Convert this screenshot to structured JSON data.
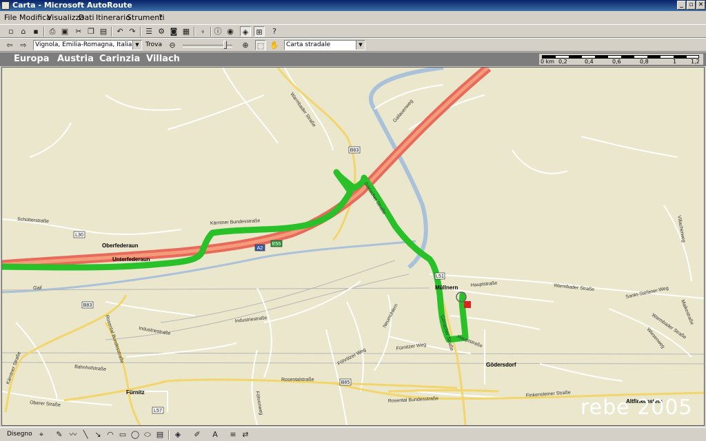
{
  "window": {
    "title": "Carta - Microsoft AutoRoute",
    "min": "_",
    "restore": "▫",
    "close": "✕"
  },
  "menu": [
    "File",
    "Modifica",
    "Visualizza",
    "Dati",
    "Itinerario",
    "Strumenti",
    "?"
  ],
  "toolbar2": {
    "location_value": "Vignola, Emilia-Romagna, Italia",
    "find_label": "Trova",
    "map_style_value": "Carta stradale",
    "back_icon": "arrow-left-icon",
    "forward_icon": "arrow-right-icon",
    "zoom_out_icon": "zoom-out-icon",
    "zoom_in_icon": "zoom-in-icon",
    "select_icon": "select-area-icon",
    "pan_icon": "hand-icon"
  },
  "breadcrumb": [
    "Europa",
    "Austria",
    "Carinzia",
    "Villach"
  ],
  "scale": {
    "unit": "0 km",
    "ticks": [
      "0,2",
      "0,4",
      "0,6",
      "0,8",
      "1",
      "1,2"
    ]
  },
  "map": {
    "places": [
      "Oberfederaun",
      "Unterfederaun",
      "Müllnern",
      "Gödersdorf",
      "Fürnitz",
      "Altfinkenstein"
    ],
    "streets": [
      "Schütterstraße",
      "Kärntner Bundesstraße",
      "Warmbader Straße",
      "Gailauenweg",
      "Göriacher Straße",
      "Hauptstraße",
      "Warmbader Straße",
      "Sankt-Stefaner-Weg",
      "Villacherweg",
      "Industriestraße",
      "Industriestraße",
      "Rosental Bundesstraße",
      "Bahnhofstraße",
      "Kärntner Straße",
      "Oberer Straße",
      "Rosentalstraße",
      "Föhrlitzer Weg",
      "Fürnitzer Weg",
      "Neumühlern",
      "Göriacher Straße",
      "Hauptstraße",
      "Finkensteiner Straße",
      "Rosental Bundesstraße",
      "Maikestraße",
      "Warmbader Straße",
      "Wiesenweg",
      "Föhrenweg",
      "Gail"
    ],
    "road_shields": [
      "B83",
      "B83",
      "L30",
      "A2",
      "E55",
      "L51",
      "B85",
      "L57"
    ]
  },
  "watermark": "rebe 2005",
  "drawbar": {
    "label": "Disegno"
  }
}
